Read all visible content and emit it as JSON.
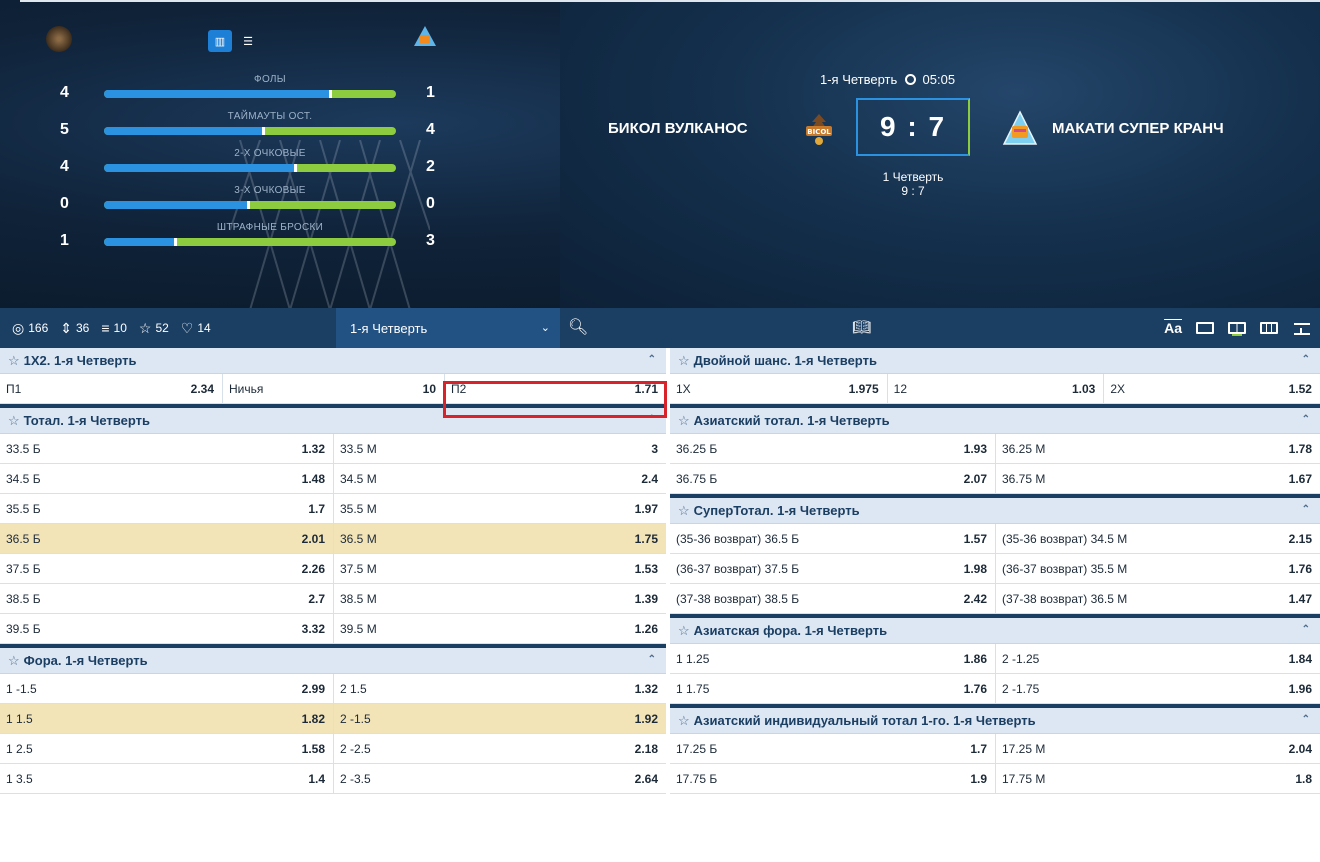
{
  "stats_mode": {
    "chart_icon": "bar-chart-icon",
    "list_icon": "list-icon"
  },
  "stats": [
    {
      "name": "ФОЛЫ",
      "home": "4",
      "away": "1",
      "home_share": 0.78
    },
    {
      "name": "ТАЙМАУТЫ ОСТ.",
      "home": "5",
      "away": "4",
      "home_share": 0.55
    },
    {
      "name": "2-Х ОЧКОВЫЕ",
      "home": "4",
      "away": "2",
      "home_share": 0.66
    },
    {
      "name": "3-Х ОЧКОВЫЕ",
      "home": "0",
      "away": "0",
      "home_share": 0.5
    },
    {
      "name": "ШТРАФНЫЕ БРОСКИ",
      "home": "1",
      "away": "3",
      "home_share": 0.25
    }
  ],
  "match": {
    "home_team": "БИКОЛ ВУЛКАНОС",
    "away_team": "МАКАТИ СУПЕР КРАНЧ",
    "period": "1-я Четверть",
    "time": "05:05",
    "score": "9 : 7",
    "sub_period_label": "1 Четверть",
    "sub_period_score": "9 : 7",
    "home_logo_text": "BICOL",
    "home_color": "#2a92e0",
    "away_color": "#8ccc3e"
  },
  "toolbar": {
    "counts": [
      {
        "icon": "target-icon",
        "value": "166"
      },
      {
        "icon": "sort-icon",
        "value": "36"
      },
      {
        "icon": "table-icon",
        "value": "10"
      },
      {
        "icon": "star-outline-icon",
        "value": "52"
      },
      {
        "icon": "trophy-icon",
        "value": "14"
      }
    ],
    "period_select": "1-я Четверть"
  },
  "left_markets": [
    {
      "title": "1X2. 1-я Четверть",
      "type": "three",
      "rows": [
        {
          "cells": [
            {
              "label": "П1",
              "odd": "2.34"
            },
            {
              "label": "Ничья",
              "odd": "10"
            },
            {
              "label": "П2",
              "odd": "1.71"
            }
          ]
        }
      ]
    },
    {
      "title": "Тотал. 1-я Четверть",
      "type": "two",
      "rows": [
        {
          "cells": [
            {
              "label": "33.5 Б",
              "odd": "1.32"
            },
            {
              "label": "33.5 М",
              "odd": "3"
            }
          ]
        },
        {
          "cells": [
            {
              "label": "34.5 Б",
              "odd": "1.48"
            },
            {
              "label": "34.5 М",
              "odd": "2.4"
            }
          ]
        },
        {
          "cells": [
            {
              "label": "35.5 Б",
              "odd": "1.7"
            },
            {
              "label": "35.5 М",
              "odd": "1.97"
            }
          ]
        },
        {
          "highlight": true,
          "cells": [
            {
              "label": "36.5 Б",
              "odd": "2.01"
            },
            {
              "label": "36.5 М",
              "odd": "1.75"
            }
          ]
        },
        {
          "cells": [
            {
              "label": "37.5 Б",
              "odd": "2.26"
            },
            {
              "label": "37.5 М",
              "odd": "1.53"
            }
          ]
        },
        {
          "cells": [
            {
              "label": "38.5 Б",
              "odd": "2.7"
            },
            {
              "label": "38.5 М",
              "odd": "1.39"
            }
          ]
        },
        {
          "cells": [
            {
              "label": "39.5 Б",
              "odd": "3.32"
            },
            {
              "label": "39.5 М",
              "odd": "1.26"
            }
          ]
        }
      ]
    },
    {
      "title": "Фора. 1-я Четверть",
      "type": "two",
      "rows": [
        {
          "cells": [
            {
              "label": "1 -1.5",
              "odd": "2.99"
            },
            {
              "label": "2 1.5",
              "odd": "1.32"
            }
          ]
        },
        {
          "highlight": true,
          "cells": [
            {
              "label": "1 1.5",
              "odd": "1.82"
            },
            {
              "label": "2 -1.5",
              "odd": "1.92"
            }
          ]
        },
        {
          "cells": [
            {
              "label": "1 2.5",
              "odd": "1.58"
            },
            {
              "label": "2 -2.5",
              "odd": "2.18"
            }
          ]
        },
        {
          "cells": [
            {
              "label": "1 3.5",
              "odd": "1.4"
            },
            {
              "label": "2 -3.5",
              "odd": "2.64"
            }
          ]
        }
      ]
    }
  ],
  "right_markets": [
    {
      "title": "Двойной шанс. 1-я Четверть",
      "type": "three",
      "rows": [
        {
          "cells": [
            {
              "label": "1X",
              "odd": "1.975"
            },
            {
              "label": "12",
              "odd": "1.03"
            },
            {
              "label": "2X",
              "odd": "1.52"
            }
          ]
        }
      ]
    },
    {
      "title": "Азиатский тотал. 1-я Четверть",
      "type": "two",
      "rows": [
        {
          "cells": [
            {
              "label": "36.25 Б",
              "odd": "1.93"
            },
            {
              "label": "36.25 М",
              "odd": "1.78"
            }
          ]
        },
        {
          "cells": [
            {
              "label": "36.75 Б",
              "odd": "2.07"
            },
            {
              "label": "36.75 М",
              "odd": "1.67"
            }
          ]
        }
      ]
    },
    {
      "title": "СуперТотал. 1-я Четверть",
      "type": "two",
      "rows": [
        {
          "cells": [
            {
              "label": "(35-36 возврат) 36.5 Б",
              "odd": "1.57"
            },
            {
              "label": "(35-36 возврат) 34.5 М",
              "odd": "2.15"
            }
          ]
        },
        {
          "cells": [
            {
              "label": "(36-37 возврат) 37.5 Б",
              "odd": "1.98"
            },
            {
              "label": "(36-37 возврат) 35.5 М",
              "odd": "1.76"
            }
          ]
        },
        {
          "cells": [
            {
              "label": "(37-38 возврат) 38.5 Б",
              "odd": "2.42"
            },
            {
              "label": "(37-38 возврат) 36.5 М",
              "odd": "1.47"
            }
          ]
        }
      ]
    },
    {
      "title": "Азиатская фора. 1-я Четверть",
      "type": "two",
      "rows": [
        {
          "cells": [
            {
              "label": "1 1.25",
              "odd": "1.86"
            },
            {
              "label": "2 -1.25",
              "odd": "1.84"
            }
          ]
        },
        {
          "cells": [
            {
              "label": "1 1.75",
              "odd": "1.76"
            },
            {
              "label": "2 -1.75",
              "odd": "1.96"
            }
          ]
        }
      ]
    },
    {
      "title": "Азиатский индивидуальный тотал 1-го. 1-я Четверть",
      "type": "two",
      "rows": [
        {
          "cells": [
            {
              "label": "17.25 Б",
              "odd": "1.7"
            },
            {
              "label": "17.25 М",
              "odd": "2.04"
            }
          ]
        },
        {
          "cells": [
            {
              "label": "17.75 Б",
              "odd": "1.9"
            },
            {
              "label": "17.75 М",
              "odd": "1.8"
            }
          ]
        }
      ]
    }
  ],
  "highlighted_outcome": "П2"
}
